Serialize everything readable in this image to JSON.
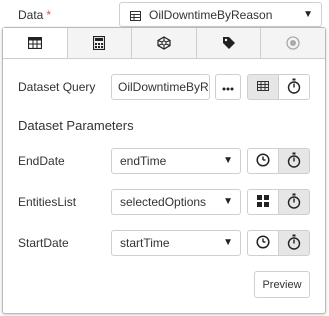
{
  "data_field": {
    "label": "Data",
    "required_marker": "*",
    "selected": "OilDowntimeByReason",
    "icon": "table-icon"
  },
  "tabs": [
    {
      "icon": "table-icon",
      "active": true
    },
    {
      "icon": "calculator-icon",
      "active": false
    },
    {
      "icon": "network-icon",
      "active": false
    },
    {
      "icon": "tag-icon",
      "active": false
    },
    {
      "icon": "radio-circle-icon",
      "active": false
    }
  ],
  "dataset_query": {
    "label": "Dataset Query",
    "value": "OilDowntimeByR",
    "more_icon": "ellipsis-icon",
    "mode_icons": [
      "table-icon",
      "stopwatch-icon"
    ]
  },
  "dataset_parameters": {
    "title": "Dataset Parameters",
    "params": [
      {
        "label": "EndDate",
        "value": "endTime",
        "icons": [
          "clock-icon",
          "stopwatch-icon"
        ]
      },
      {
        "label": "EntitiesList",
        "value": "selectedOptions",
        "icons": [
          "grid-icon",
          "stopwatch-icon"
        ]
      },
      {
        "label": "StartDate",
        "value": "startTime",
        "icons": [
          "clock-icon",
          "stopwatch-icon"
        ]
      }
    ]
  },
  "preview_label": "Preview",
  "colors": {
    "required": "#d9534f",
    "border": "#cfcfcf",
    "active_button_bg": "#e6e6e6",
    "tab_bg": "#f4f4f4"
  }
}
